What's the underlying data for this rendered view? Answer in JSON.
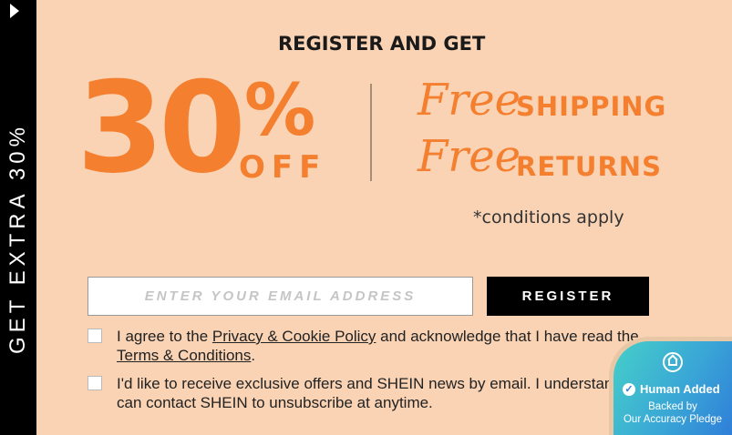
{
  "side_tab": {
    "label": "GET EXTRA 30%"
  },
  "promo": {
    "headline": "REGISTER AND GET",
    "discount_number": "30",
    "discount_percent": "%",
    "discount_off": "OFF",
    "free_word": "Free",
    "perk_shipping": "SHIPPING",
    "perk_returns": "RETURNS",
    "conditions": "*conditions apply"
  },
  "form": {
    "email_placeholder": "ENTER YOUR EMAIL ADDRESS",
    "register_label": "REGISTER",
    "consent_1": {
      "prefix": "I agree to the ",
      "privacy_link": "Privacy & Cookie Policy",
      "middle": " and acknowledge that I have read the ",
      "terms_link": "Terms & Conditions",
      "suffix": "."
    },
    "consent_2": "I'd like to receive exclusive offers and SHEIN news by email. I understand I can contact SHEIN to unsubscribe at anytime."
  },
  "badge": {
    "title": "Human Added",
    "subtitle_1": "Backed by",
    "subtitle_2": "Our Accuracy Pledge",
    "check_glyph": "✓"
  },
  "colors": {
    "accent": "#f47f2f",
    "background": "#f9d3b4",
    "dark": "#000000",
    "badge": "#3aa7d6"
  }
}
